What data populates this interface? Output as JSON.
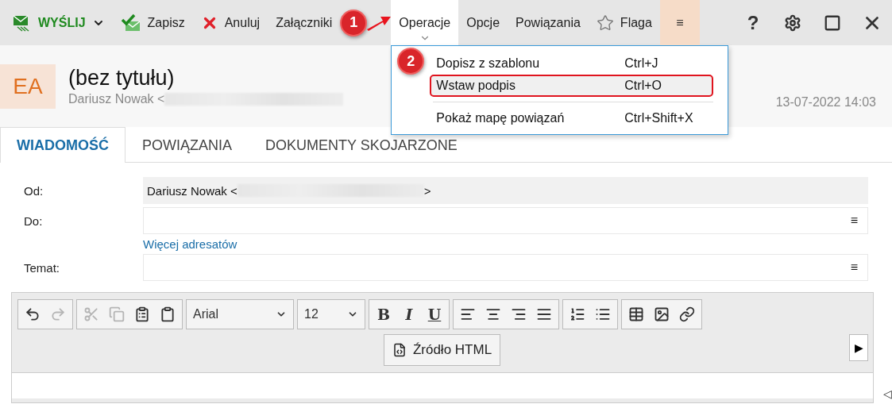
{
  "toolbar": {
    "items": [
      {
        "kind": "send",
        "label": "WYŚLIJ",
        "selected": false
      },
      {
        "kind": "save",
        "label": "Zapisz",
        "selected": false
      },
      {
        "kind": "cancel",
        "label": "Anuluj",
        "selected": false
      },
      {
        "kind": "plain",
        "label": "Załączniki",
        "selected": false
      },
      {
        "kind": "plain",
        "label": "Operacje",
        "selected": true
      },
      {
        "kind": "plain",
        "label": "Opcje",
        "selected": false
      },
      {
        "kind": "plain",
        "label": "Powiązania",
        "selected": false
      },
      {
        "kind": "flag",
        "label": "Flaga",
        "selected": false
      },
      {
        "kind": "menu",
        "label": "≡",
        "selected": false
      }
    ],
    "window_controls": [
      {
        "kind": "help",
        "label": "?"
      },
      {
        "kind": "settings"
      },
      {
        "kind": "maximize"
      },
      {
        "kind": "close"
      }
    ]
  },
  "dropdown": {
    "items": [
      {
        "kind": "item",
        "label": "Dopisz z szablonu",
        "shortcut": "Ctrl+J",
        "highlighted": false
      },
      {
        "kind": "item",
        "label": "Wstaw podpis",
        "shortcut": "Ctrl+O",
        "highlighted": true
      },
      {
        "kind": "separator"
      },
      {
        "kind": "item",
        "label": "Pokaż mapę powiązań",
        "shortcut": "Ctrl+Shift+X",
        "highlighted": false
      }
    ]
  },
  "annotations": [
    {
      "label": "1"
    },
    {
      "label": "2"
    }
  ],
  "header": {
    "avatar": "EA",
    "title": "(bez tytułu)",
    "sender": "Dariusz Nowak <",
    "date": "13-07-2022 14:03"
  },
  "tabs": [
    {
      "label": "WIADOMOŚĆ",
      "selected": true
    },
    {
      "label": "POWIĄZANIA",
      "selected": false
    },
    {
      "label": "DOKUMENTY SKOJARZONE",
      "selected": false
    }
  ],
  "form": {
    "from": {
      "label": "Od:",
      "value": "Dariusz Nowak <",
      "suffix": ">"
    },
    "to": {
      "label": "Do:",
      "menu": "≡"
    },
    "more_link": "Więcej adresatów",
    "subject": {
      "label": "Temat:",
      "menu": "≡"
    }
  },
  "editor": {
    "groups": [
      [
        {
          "kind": "undo",
          "disabled": false
        },
        {
          "kind": "redo",
          "disabled": true
        }
      ],
      [
        {
          "kind": "cut",
          "disabled": true
        },
        {
          "kind": "copy",
          "disabled": true
        },
        {
          "kind": "paste",
          "disabled": false
        },
        {
          "kind": "paste-text",
          "disabled": false
        }
      ],
      [
        {
          "kind": "font-family",
          "label": "Arial"
        }
      ],
      [
        {
          "kind": "font-size",
          "label": "12"
        }
      ],
      [
        {
          "kind": "bold",
          "label": "B"
        },
        {
          "kind": "italic",
          "label": "I"
        },
        {
          "kind": "underline",
          "label": "U"
        }
      ],
      [
        {
          "kind": "align-left"
        },
        {
          "kind": "align-center"
        },
        {
          "kind": "align-right"
        },
        {
          "kind": "align-justify"
        }
      ],
      [
        {
          "kind": "ordered-list"
        },
        {
          "kind": "bullet-list"
        }
      ],
      [
        {
          "kind": "table"
        },
        {
          "kind": "image"
        },
        {
          "kind": "link"
        }
      ]
    ],
    "source_button": "Źródło HTML",
    "more_button": "▶",
    "collapse": "◁"
  }
}
